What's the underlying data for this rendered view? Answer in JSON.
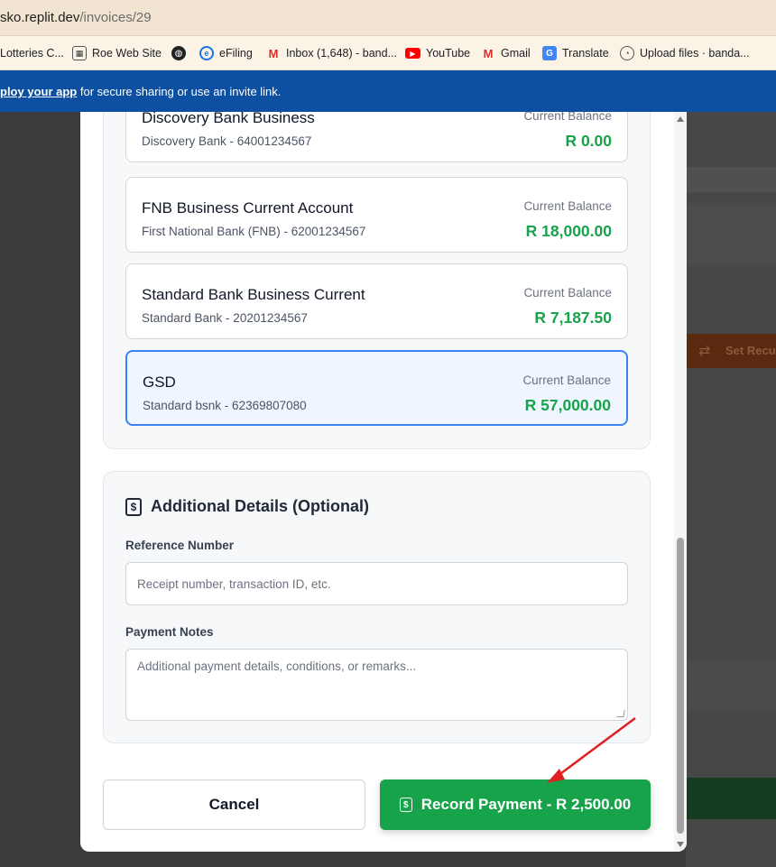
{
  "browser": {
    "url_host": "sko.replit.dev",
    "url_path": "/invoices/29",
    "bookmarks": [
      {
        "label": "Lotteries C...",
        "icon": "bookmark-icon"
      },
      {
        "label": "Roe Web Site",
        "icon": "site-icon"
      },
      {
        "label": "",
        "icon": "globe-icon"
      },
      {
        "label": "eFiling",
        "icon": "efiling-icon"
      },
      {
        "label": "Inbox (1,648) - band...",
        "icon": "gmail-icon"
      },
      {
        "label": "YouTube",
        "icon": "youtube-icon"
      },
      {
        "label": "Gmail",
        "icon": "gmail-icon"
      },
      {
        "label": "Translate",
        "icon": "translate-icon"
      },
      {
        "label": "Upload files · banda...",
        "icon": "github-icon"
      }
    ]
  },
  "banner": {
    "link_text": "ploy your app",
    "text": " for secure sharing or use an invite link."
  },
  "background": {
    "recurring_label": "Set Recu"
  },
  "accounts": [
    {
      "name": "Discovery Bank Business",
      "sub": "Discovery Bank - 64001234567",
      "balance_label": "Current Balance",
      "balance": "R 0.00",
      "selected": false
    },
    {
      "name": "FNB Business Current Account",
      "sub": "First National Bank (FNB) - 62001234567",
      "balance_label": "Current Balance",
      "balance": "R 18,000.00",
      "selected": false
    },
    {
      "name": "Standard Bank Business Current",
      "sub": "Standard Bank - 20201234567",
      "balance_label": "Current Balance",
      "balance": "R 7,187.50",
      "selected": false
    },
    {
      "name": "GSD",
      "sub": "Standard bsnk - 62369807080",
      "balance_label": "Current Balance",
      "balance": "R 57,000.00",
      "selected": true
    }
  ],
  "details": {
    "title": "Additional Details (Optional)",
    "reference_label": "Reference Number",
    "reference_placeholder": "Receipt number, transaction ID, etc.",
    "reference_value": "",
    "notes_label": "Payment Notes",
    "notes_placeholder": "Additional payment details, conditions, or remarks...",
    "notes_value": ""
  },
  "actions": {
    "cancel_label": "Cancel",
    "record_label": "Record Payment - R 2,500.00"
  },
  "colors": {
    "primary_green": "#16a34a",
    "selected_blue": "#3b82f6",
    "banner_blue": "#0d4fa0",
    "annotation_red": "#e02020"
  }
}
